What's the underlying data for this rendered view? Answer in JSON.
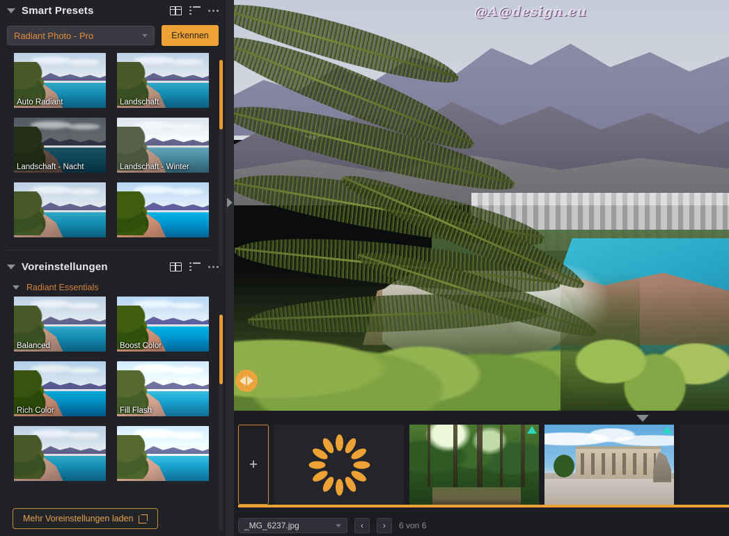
{
  "smart_presets": {
    "title": "Smart Presets",
    "icons": {
      "grid": "grid-view-icon",
      "list": "list-view-icon",
      "more": "more-options-icon"
    },
    "selector": {
      "value": "Radiant Photo - Pro",
      "caret": "chevron-down-icon"
    },
    "detect_button": "Erkennen",
    "items": [
      {
        "label": "Auto Radiant",
        "variant": "v-balanced"
      },
      {
        "label": "Landschaft",
        "variant": "v-balanced"
      },
      {
        "label": "Landschaft - Nacht",
        "variant": "v-nacht"
      },
      {
        "label": "Landschaft - Winter",
        "variant": "v-winter"
      },
      {
        "label": "",
        "variant": "v-balanced"
      },
      {
        "label": "",
        "variant": "v-boost"
      }
    ]
  },
  "presets": {
    "title": "Voreinstellungen",
    "group_label": "Radiant Essentials",
    "items": [
      {
        "label": "Balanced",
        "variant": "v-balanced"
      },
      {
        "label": "Boost Color",
        "variant": "v-boost"
      },
      {
        "label": "Rich Color",
        "variant": "v-rich"
      },
      {
        "label": "Fill Flash",
        "variant": "v-fill"
      },
      {
        "label": "",
        "variant": "v-balanced"
      },
      {
        "label": "",
        "variant": "v-fill"
      }
    ],
    "load_more": "Mehr Voreinstellungen laden",
    "load_more_icon": "external-link-icon"
  },
  "preview": {
    "watermark": "@A@design.eu",
    "compare_icon": "before-after-compare-icon",
    "collapse_icon": "collapse-panel-icon"
  },
  "filmstrip": {
    "chevron_icon": "chevron-down-icon",
    "add_label": "+",
    "tiles": [
      {
        "kind": "loading",
        "badge": false
      },
      {
        "kind": "forest",
        "badge": true
      },
      {
        "kind": "palace",
        "badge": true
      },
      {
        "kind": "plain",
        "badge": false
      },
      {
        "kind": "dark",
        "badge": false
      }
    ]
  },
  "bottom_bar": {
    "file_name": "_MG_6237.jpg",
    "prev_icon": "chevron-left-icon",
    "next_icon": "chevron-right-icon",
    "prev_label": "‹",
    "next_label": "›",
    "counter": "6 von 6"
  },
  "colors": {
    "accent": "#eca235",
    "accent_text": "#e08a3c",
    "group_text": "#d4803a",
    "panel_bg": "#212228",
    "app_bg": "#1c1d22",
    "badge": "#2fd6c0"
  }
}
